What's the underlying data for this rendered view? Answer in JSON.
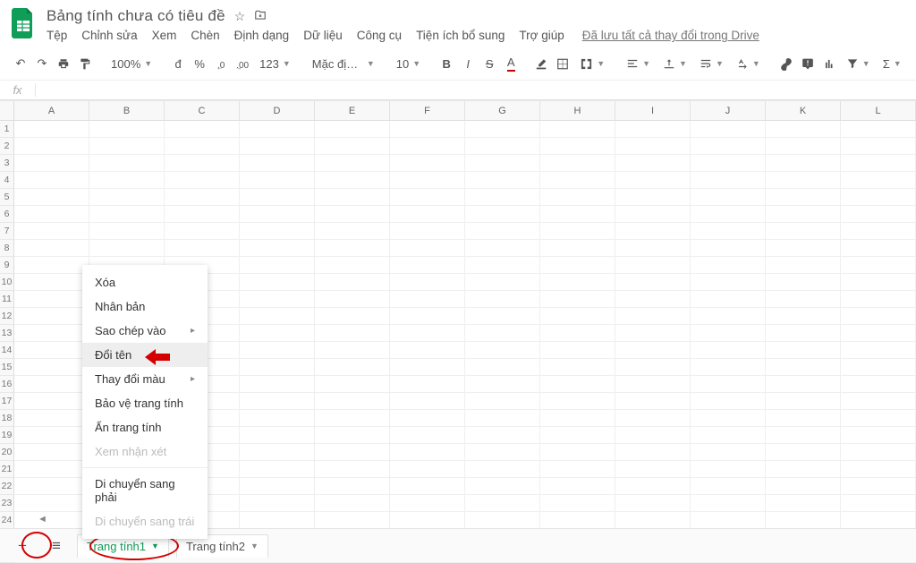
{
  "header": {
    "title": "Bảng tính chưa có tiêu đề",
    "menus": [
      "Tệp",
      "Chỉnh sửa",
      "Xem",
      "Chèn",
      "Định dạng",
      "Dữ liệu",
      "Công cụ",
      "Tiện ích bổ sung",
      "Trợ giúp"
    ],
    "save_status": "Đã lưu tất cả thay đổi trong Drive"
  },
  "toolbar": {
    "zoom": "100%",
    "currency": "đ",
    "percent": "%",
    "dec_less": ".0",
    "dec_more": ".00",
    "number_fmt": "123",
    "font": "Mặc định (…",
    "font_size": "10"
  },
  "fx": {
    "label": "fx"
  },
  "columns": [
    "A",
    "B",
    "C",
    "D",
    "E",
    "F",
    "G",
    "H",
    "I",
    "J",
    "K",
    "L"
  ],
  "rows": 26,
  "context_menu": {
    "items": [
      {
        "label": "Xóa",
        "disabled": false,
        "sub": false,
        "hover": false
      },
      {
        "label": "Nhân bản",
        "disabled": false,
        "sub": false,
        "hover": false
      },
      {
        "label": "Sao chép vào",
        "disabled": false,
        "sub": true,
        "hover": false
      },
      {
        "label": "Đổi tên",
        "disabled": false,
        "sub": false,
        "hover": true
      },
      {
        "label": "Thay đổi màu",
        "disabled": false,
        "sub": true,
        "hover": false
      },
      {
        "label": "Bảo vệ trang tính",
        "disabled": false,
        "sub": false,
        "hover": false
      },
      {
        "label": "Ẩn trang tính",
        "disabled": false,
        "sub": false,
        "hover": false
      },
      {
        "label": "Xem nhận xét",
        "disabled": true,
        "sub": false,
        "hover": false
      },
      {
        "sep": true
      },
      {
        "label": "Di chuyển sang phải",
        "disabled": false,
        "sub": false,
        "hover": false
      },
      {
        "label": "Di chuyển sang trái",
        "disabled": true,
        "sub": false,
        "hover": false
      }
    ]
  },
  "tabs": {
    "active": "Trang tính1",
    "inactive": "Trang tính2"
  }
}
